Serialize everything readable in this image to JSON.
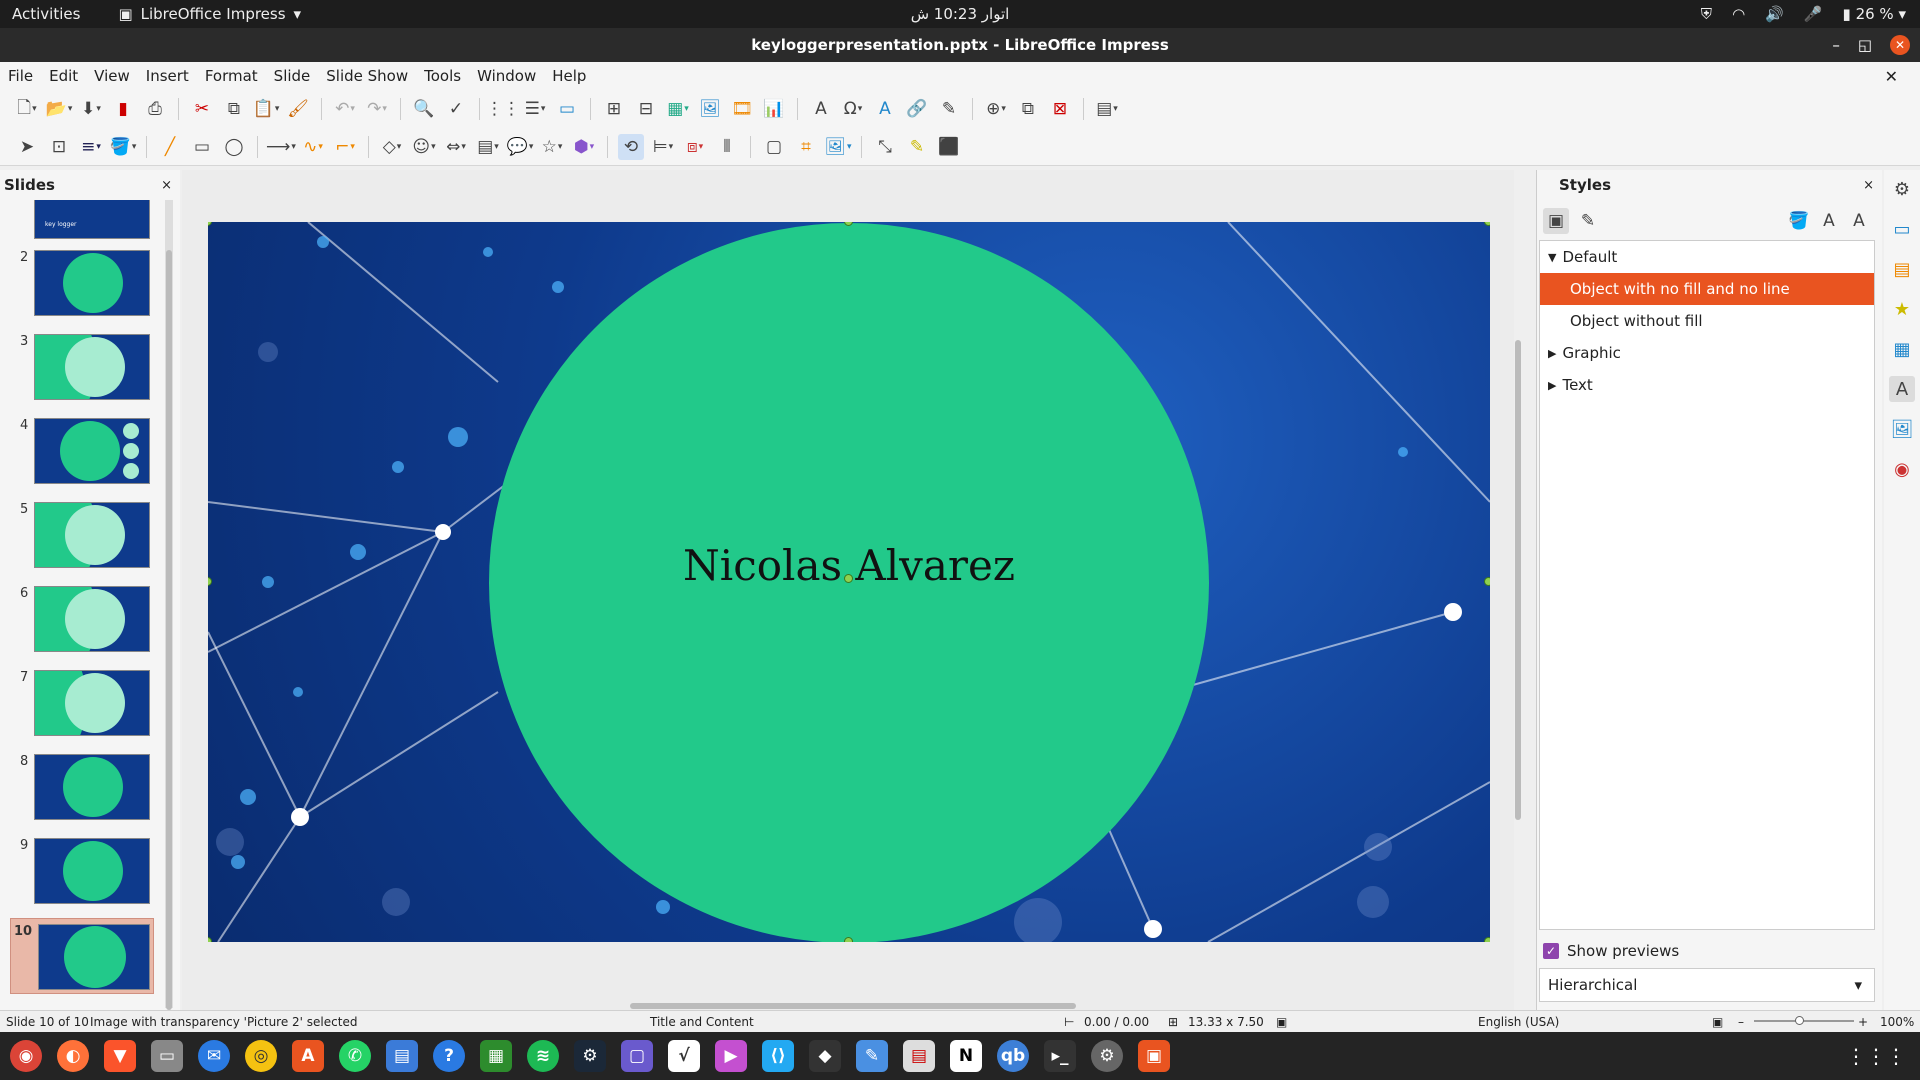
{
  "topbar": {
    "activities": "Activities",
    "app_name": "LibreOffice Impress",
    "clock": "اتوار 10:23 ش",
    "battery": "26 %"
  },
  "window": {
    "title": "keyloggerpresentation.pptx - LibreOffice Impress"
  },
  "menu": [
    "File",
    "Edit",
    "View",
    "Insert",
    "Format",
    "Slide",
    "Slide Show",
    "Tools",
    "Window",
    "Help"
  ],
  "slides_panel": {
    "title": "Slides",
    "close": "×",
    "slide_numbers": [
      "2",
      "3",
      "4",
      "5",
      "6",
      "7",
      "8",
      "9",
      "10"
    ],
    "first_thumb_label": "key logger"
  },
  "slide": {
    "name_text": "Nicolas Alvarez"
  },
  "styles_panel": {
    "title": "Styles",
    "close": "×",
    "tree": {
      "default": "Default",
      "no_fill_no_line": "Object with no fill and no line",
      "without_fill": "Object without fill",
      "graphic": "Graphic",
      "text": "Text"
    },
    "show_previews": "Show previews",
    "mode": "Hierarchical"
  },
  "status": {
    "slide": "Slide 10 of 10",
    "selection": "Image with transparency 'Picture 2' selected",
    "layout": "Title and Content",
    "position": "0.00 / 0.00",
    "size": "13.33 x 7.50",
    "language": "English (USA)",
    "zoom": "100%"
  },
  "colors": {
    "accent": "#e95420",
    "circle": "#22c98a",
    "slide_bg": "#0e3a8c"
  }
}
